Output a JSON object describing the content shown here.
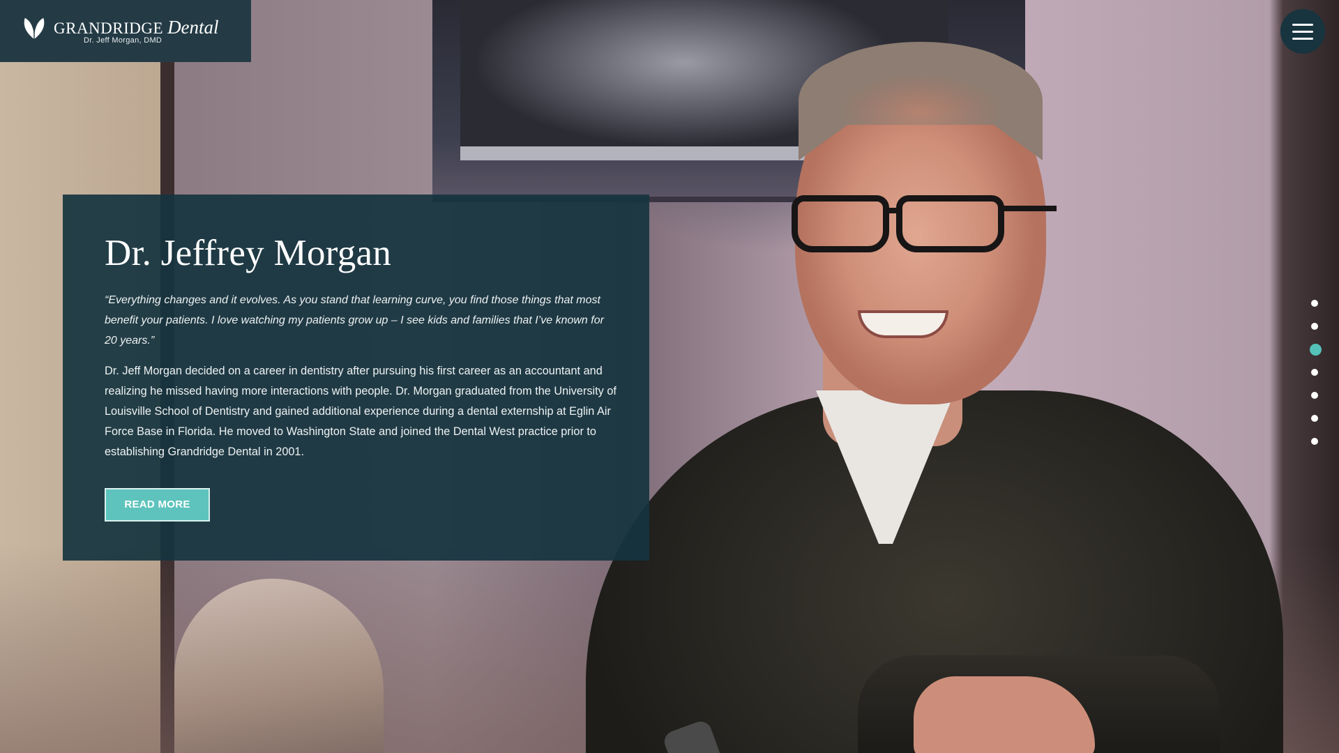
{
  "logo": {
    "brand": "GRANDRIDGE",
    "brand_script": "Dental",
    "subtitle": "Dr. Jeff Morgan, DMD",
    "leaf_icon": "leaf-icon"
  },
  "menu": {
    "icon": "hamburger-menu-icon"
  },
  "profile": {
    "name": "Dr. Jeffrey Morgan",
    "quote": "“Everything changes and it evolves. As you stand that learning curve, you find those things that most benefit your patients. I love watching my patients grow up – I see kids and families that I’ve known for 20 years.”",
    "bio": "Dr. Jeff Morgan decided on a career in dentistry after pursuing his first career as an accountant and realizing he missed having more interactions with people. Dr. Morgan graduated from the University of Louisville School of Dentistry and gained additional experience during a dental externship at Eglin Air Force Base in Florida. He moved to Washington State and joined the Dental West practice prior to establishing Grandridge Dental in 2001.",
    "button_label": "READ MORE"
  },
  "section_nav": {
    "count": 7,
    "active_index": 2
  },
  "colors": {
    "card_bg": "#16343f",
    "accent": "#5ec3bd",
    "logo_bg": "#243b45"
  }
}
